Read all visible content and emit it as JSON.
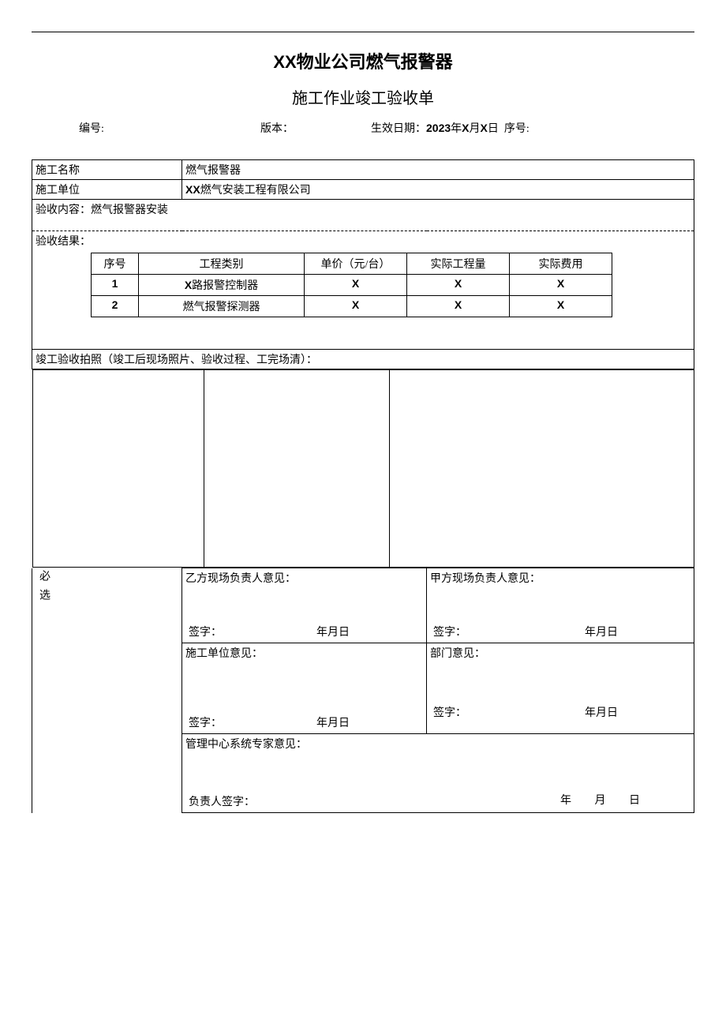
{
  "header": {
    "title_company": "XX",
    "title_rest": "物业公司燃气报警器",
    "subtitle": "施工作业竣工验收单",
    "bh_label": "编号:",
    "bb_label": "版本：",
    "sx_label": "生效日期：",
    "sx_year": "2023",
    "sx_mid1": "年",
    "sx_x1": "X",
    "sx_mid2": "月",
    "sx_x2": "X",
    "sx_mid3": "日",
    "xh_label": "序号:"
  },
  "info": {
    "name_label": "施工名称",
    "name_value": "燃气报警器",
    "unit_label": "施工单位",
    "unit_prefix": "XX",
    "unit_rest": "燃气安装工程有限公司",
    "content_label": "验收内容：燃气报警器安装"
  },
  "results": {
    "label": "验收结果：",
    "headers": {
      "seq": "序号",
      "cat": "工程类别",
      "price": "单价（元/台）",
      "qty": "实际工程量",
      "cost": "实际费用"
    },
    "rows": [
      {
        "seq": "1",
        "cat_prefix": "X",
        "cat_rest": "路报警控制器",
        "price": "X",
        "qty": "X",
        "cost": "X"
      },
      {
        "seq": "2",
        "cat_prefix": "",
        "cat_rest": "燃气报警探测器",
        "price": "X",
        "qty": "X",
        "cost": "X"
      }
    ]
  },
  "photos": {
    "label": "竣工验收拍照（竣工后现场照片、验收过程、工完场清）："
  },
  "opinions": {
    "side_label": "必选",
    "yf_label": "乙方现场负责人意见：",
    "jf_label": "甲方现场负责人意见：",
    "sgdw_label": "施工单位意见：",
    "bm_label": "部门意见：",
    "expert_label": "管理中心系统专家意见：",
    "sig_label": "签字：",
    "sig_label_expert": "负责人签字：",
    "date_ymd": "年月日",
    "y": "年",
    "m": "月",
    "d": "日"
  }
}
